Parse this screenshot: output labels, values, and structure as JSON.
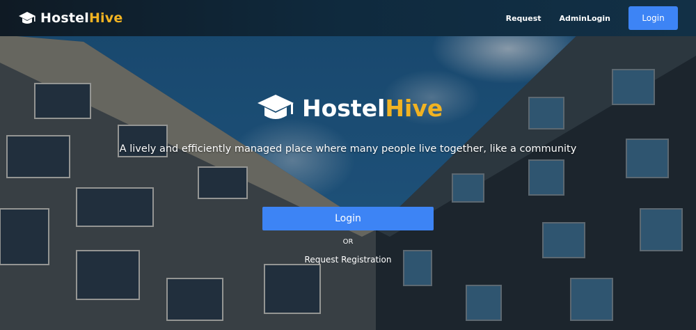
{
  "navbar": {
    "brand_prefix": "Hostel",
    "brand_suffix": "Hive",
    "links": [
      "Request",
      "AdminLogin"
    ],
    "login_label": "Login"
  },
  "hero": {
    "title_prefix": "Hostel",
    "title_suffix": "Hive",
    "tagline": "A lively and efficiently managed place where many people live together, like a community",
    "login_label": "Login",
    "or_text": "OR",
    "request_label": "Request Registration"
  },
  "colors": {
    "accent_blue": "#3d84f5",
    "brand_yellow": "#f1b322",
    "navbar_bg": "#0f2434"
  },
  "icons": {
    "brand": "graduation-cap-icon"
  }
}
